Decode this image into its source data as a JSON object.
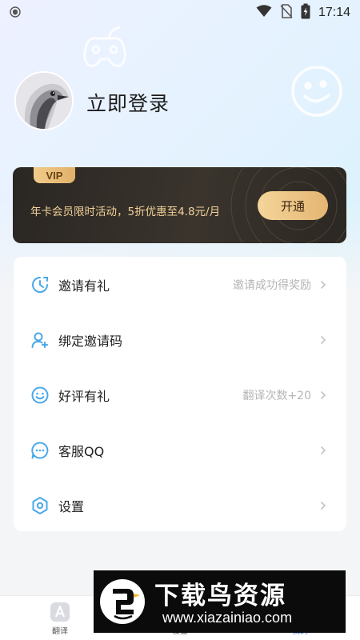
{
  "status_bar": {
    "time": "17:14",
    "icons": [
      "shield-icon",
      "wifi-icon",
      "no-sim-icon",
      "battery-charging-icon"
    ]
  },
  "profile": {
    "login_text": "立即登录"
  },
  "vip": {
    "badge": "VIP",
    "promo": "年卡会员限时活动，5折优惠至4.8元/月",
    "button": "开通"
  },
  "menu": {
    "items": [
      {
        "label": "邀请有礼",
        "hint": "邀请成功得奖励",
        "icon": "invite-gift-icon"
      },
      {
        "label": "绑定邀请码",
        "hint": "",
        "icon": "add-user-icon"
      },
      {
        "label": "好评有礼",
        "hint": "翻译次数+20",
        "icon": "smile-icon"
      },
      {
        "label": "客服QQ",
        "hint": "",
        "icon": "chat-icon"
      },
      {
        "label": "设置",
        "hint": "",
        "icon": "gear-icon"
      }
    ]
  },
  "bottom_nav": {
    "items": [
      {
        "label": "翻译",
        "icon": "translate-icon"
      },
      {
        "label": "设置",
        "icon": "settings-icon"
      },
      {
        "label": "我的",
        "icon": "profile-icon"
      }
    ]
  },
  "watermark": {
    "title": "下载鸟资源",
    "url": "www.xiazainiao.com"
  },
  "colors": {
    "accent": "#3a7cf6",
    "menu_icon": "#4aa8e8",
    "vip_gold": "#f3d29a",
    "vip_dark": "#2f2a25"
  }
}
